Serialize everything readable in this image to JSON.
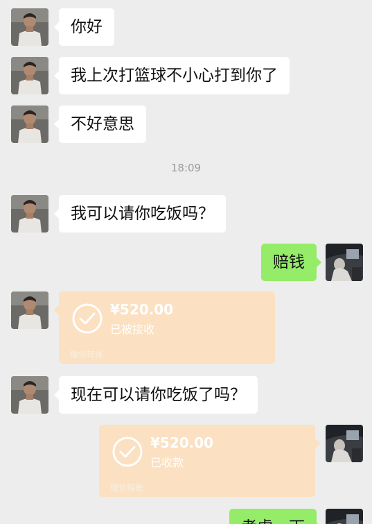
{
  "messages": {
    "m1": "你好",
    "m2": "我上次打篮球不小心打到你了",
    "m3": "不好意思",
    "m4": "我可以请你吃饭吗？",
    "m5": "赔钱",
    "m6": "现在可以请你吃饭了吗？",
    "m7": "考虑一下"
  },
  "timestamp": "18:09",
  "transfer_received": {
    "amount": "¥520.00",
    "status": "已被接收",
    "footer": "微信转账"
  },
  "transfer_confirmed": {
    "amount": "¥520.00",
    "status": "已收款",
    "footer": "微信转账"
  },
  "colors": {
    "background": "#ededed",
    "incoming_bubble": "#ffffff",
    "outgoing_bubble": "#95ec69",
    "transfer_card": "#fbe0c1"
  },
  "icons": {
    "avatar_left": "shirtless-man-avatar",
    "avatar_right": "car-interior-avatar",
    "transfer_check": "check-circle-icon"
  }
}
